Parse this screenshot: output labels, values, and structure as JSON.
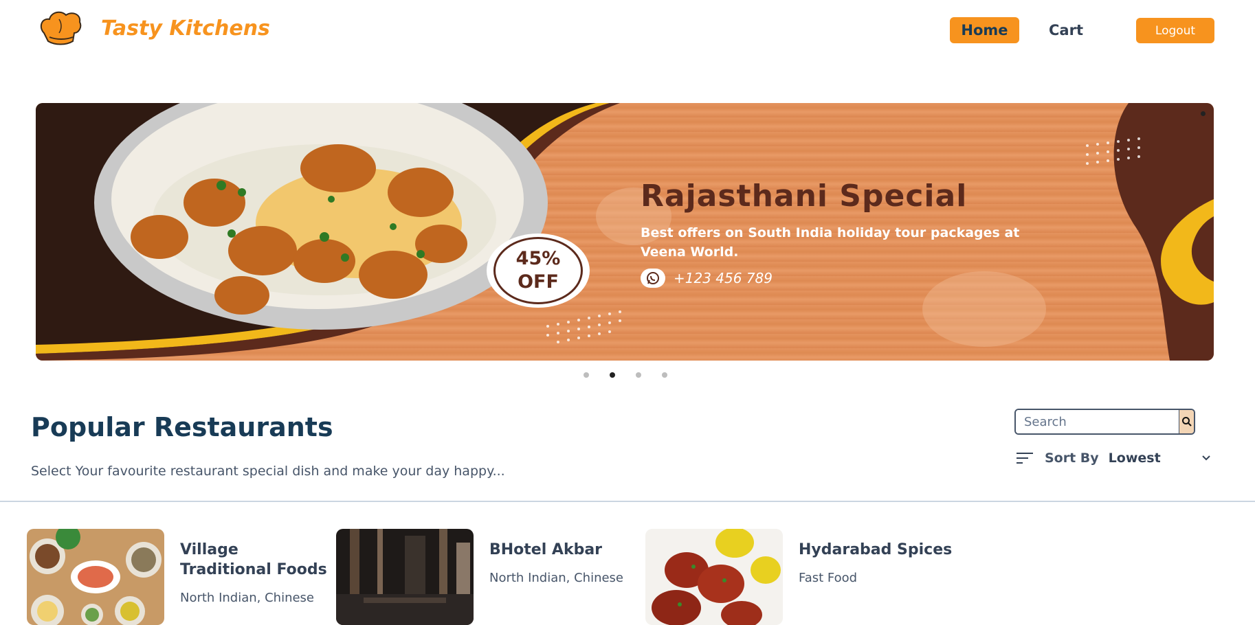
{
  "header": {
    "brand": "Tasty Kitchens",
    "nav": {
      "home": "Home",
      "cart": "Cart",
      "logout": "Logout"
    }
  },
  "banner": {
    "title": "Rajasthani Special",
    "description": "Best offers on South India holiday tour packages at Veena World.",
    "phone": "+123 456 789",
    "discount_percent": "45%",
    "discount_word": "OFF",
    "slide_count": 4,
    "active_slide": 2
  },
  "section": {
    "title": "Popular Restaurants",
    "subtitle": "Select Your favourite restaurant special dish and make your day happy..."
  },
  "search": {
    "placeholder": "Search",
    "icon": "search-icon"
  },
  "sort": {
    "label": "Sort By",
    "value": "Lowest",
    "icon": "sort-icon"
  },
  "restaurants": [
    {
      "name": "Village Traditional Foods",
      "cuisine": "North Indian, Chinese"
    },
    {
      "name": "BHotel Akbar",
      "cuisine": "North Indian, Chinese"
    },
    {
      "name": "Hydarabad Spices",
      "cuisine": "Fast Food"
    }
  ],
  "colors": {
    "accent": "#f7931e",
    "heading": "#183b56",
    "banner_brown": "#5c2a1c",
    "banner_wood": "#e4935e"
  }
}
